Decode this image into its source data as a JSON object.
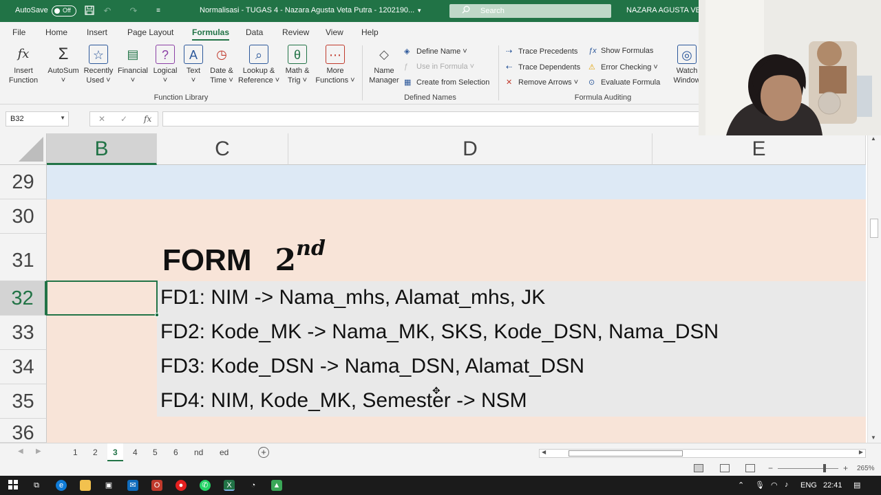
{
  "titlebar": {
    "autosave_label": "AutoSave",
    "autosave_state": "Off",
    "doc_title": "Normalisasi - TUGAS 4 - Nazara Agusta Veta Putra - 1202190...",
    "search_placeholder": "Search",
    "user_name": "NAZARA AGUSTA VET"
  },
  "ribbon_tabs": [
    "File",
    "Home",
    "Insert",
    "Page Layout",
    "Formulas",
    "Data",
    "Review",
    "View",
    "Help"
  ],
  "active_tab": "Formulas",
  "function_library": {
    "label": "Function Library",
    "buttons": [
      {
        "line1": "Insert",
        "line2": "Function"
      },
      {
        "line1": "AutoSum",
        "line2": "˅"
      },
      {
        "line1": "Recently",
        "line2": "Used ˅"
      },
      {
        "line1": "Financial",
        "line2": "˅"
      },
      {
        "line1": "Logical",
        "line2": "˅"
      },
      {
        "line1": "Text",
        "line2": "˅"
      },
      {
        "line1": "Date &",
        "line2": "Time ˅"
      },
      {
        "line1": "Lookup &",
        "line2": "Reference ˅"
      },
      {
        "line1": "Math &",
        "line2": "Trig ˅"
      },
      {
        "line1": "More",
        "line2": "Functions ˅"
      }
    ]
  },
  "defined_names": {
    "label": "Defined Names",
    "manager_line1": "Name",
    "manager_line2": "Manager",
    "define_name": "Define Name ˅",
    "use_in_formula": "Use in Formula ˅",
    "create_from_selection": "Create from Selection"
  },
  "formula_auditing": {
    "label": "Formula Auditing",
    "trace_precedents": "Trace Precedents",
    "trace_dependents": "Trace Dependents",
    "remove_arrows": "Remove Arrows ˅",
    "show_formulas": "Show Formulas",
    "error_checking": "Error Checking ˅",
    "evaluate_formula": "Evaluate Formula",
    "watch_line1": "Watch",
    "watch_line2": "Window"
  },
  "formula_bar": {
    "name_box": "B32",
    "cancel_symbol": "✕",
    "enter_symbol": "✓",
    "fx_symbol": "fx",
    "value": ""
  },
  "columns": [
    "B",
    "C",
    "D",
    "E"
  ],
  "selected_column": "B",
  "rows": [
    "29",
    "30",
    "31",
    "32",
    "33",
    "34",
    "35",
    "36"
  ],
  "selected_row": "32",
  "sheet_content": {
    "form_word": "FORM",
    "form_number": "2",
    "form_suffix": "nd",
    "fd_lines": [
      "FD1: NIM -> Nama_mhs, Alamat_mhs, JK",
      "FD2: Kode_MK -> Nama_MK, SKS, Kode_DSN, Nama_DSN",
      "FD3: Kode_DSN -> Nama_DSN, Alamat_DSN",
      "FD4: NIM, Kode_MK, Semester -> NSM"
    ]
  },
  "sheet_tabs": [
    "1",
    "2",
    "3",
    "4",
    "5",
    "6",
    "nd",
    "ed"
  ],
  "active_sheet": "3",
  "status": {
    "zoom": "265%",
    "zoom_minus": "−",
    "zoom_plus": "+"
  },
  "taskbar": {
    "language": "ENG",
    "time": "22:41"
  },
  "colors": {
    "excel_green": "#217346",
    "peach_fill": "#f8e4d8",
    "blue_fill": "#dde9f5",
    "gray_fill": "#e9e9e9"
  }
}
